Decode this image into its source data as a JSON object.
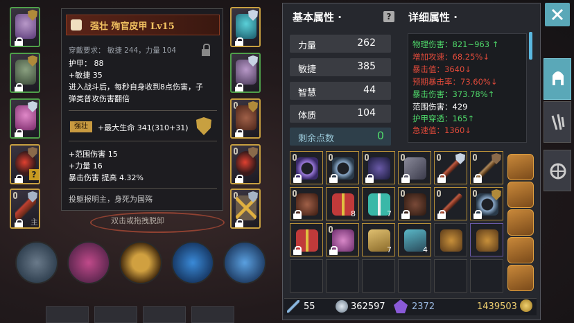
{
  "tooltip": {
    "title": "强壮 殉官皮甲 Lv15",
    "requirement": "穿戴要求：  敏捷 244，力量 104",
    "armor": "护甲：  88",
    "agility": "+敏捷  35",
    "effect_line1": "进入战斗后，每秒自身收到8点伤害，子",
    "effect_line2": "弹类普攻伤害翻倍",
    "enhance_tag": "强壮",
    "enhance_text": "+最大生命 341(310+31)",
    "bonus1": "+范围伤害  15",
    "bonus2": "+力量  16",
    "bonus3": "暴击伤害  提高  4.32%",
    "flavor": "投躯报明主，身死为国殇"
  },
  "drag_hint": "双击或拖拽脱卸",
  "slot_main_label": "主",
  "basic": {
    "title": "基本属性 ·",
    "stats": [
      {
        "name": "力量",
        "value": "262"
      },
      {
        "name": "敏捷",
        "value": "385"
      },
      {
        "name": "智慧",
        "value": "44"
      },
      {
        "name": "体质",
        "value": "104"
      }
    ],
    "remaining_label": "剩余点数",
    "remaining_value": "0"
  },
  "detail": {
    "title": "详细属性 ·",
    "lines": [
      {
        "text": "物理伤害：821~963 ↑",
        "color": "#4fd86a"
      },
      {
        "text": "增加攻速：68.25%↓",
        "color": "#e04a3a"
      },
      {
        "text": "暴击值：3640↓",
        "color": "#e04a3a"
      },
      {
        "text": "预期暴击率：73.60%↓",
        "color": "#e04a3a"
      },
      {
        "text": "暴击伤害：373.78%↑",
        "color": "#4fd86a"
      },
      {
        "text": "范围伤害：429",
        "color": "#ffffff"
      },
      {
        "text": "护甲穿透：165↑",
        "color": "#4fd86a"
      },
      {
        "text": "急速值：1360↓",
        "color": "#e04a3a"
      }
    ]
  },
  "inventory": {
    "counts": {
      "gift_box": "8",
      "teal_box": "7",
      "scroll": "7",
      "map": "4"
    }
  },
  "bottom_bar": {
    "sword_level": "55",
    "orb_count": "362597",
    "gem_count": "2372",
    "gold": "1439503"
  },
  "icons": [
    "close-icon",
    "helmet-icon",
    "gloves-icon",
    "wheel-icon",
    "help-icon"
  ]
}
